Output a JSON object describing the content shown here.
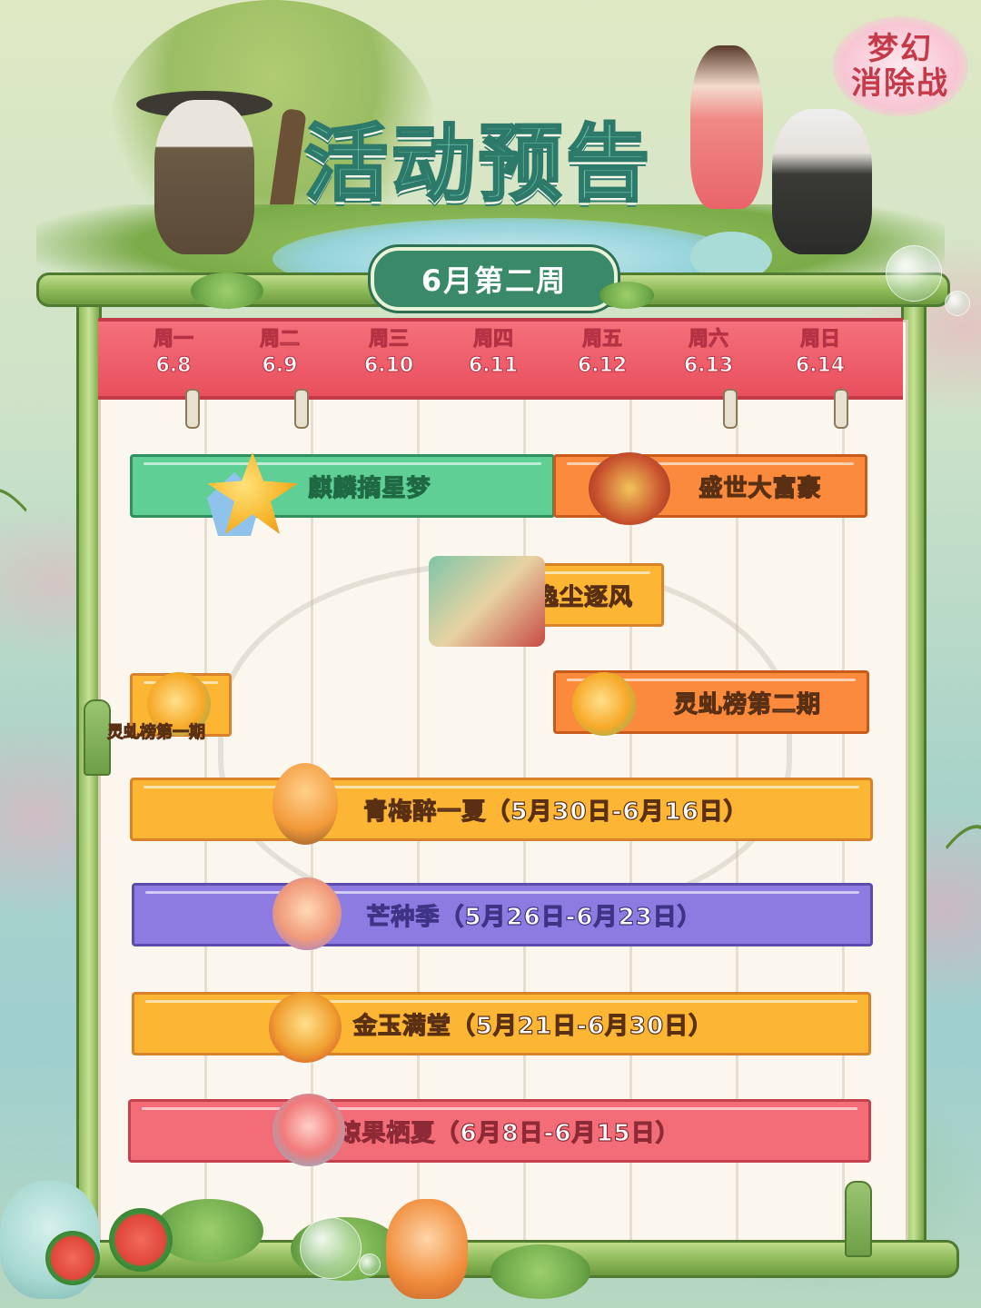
{
  "logo": {
    "line1": "梦幻",
    "line2": "消除战"
  },
  "title": "活动预告",
  "week_label": "6月第二周",
  "days": [
    {
      "name": "周一",
      "date": "6.8"
    },
    {
      "name": "周二",
      "date": "6.9"
    },
    {
      "name": "周三",
      "date": "6.10"
    },
    {
      "name": "周四",
      "date": "6.11"
    },
    {
      "name": "周五",
      "date": "6.12"
    },
    {
      "name": "周六",
      "date": "6.13"
    },
    {
      "name": "周日",
      "date": "6.14"
    }
  ],
  "events": {
    "qilin": {
      "label": "麒麟摘星梦",
      "color": "#5fcf96",
      "icon": "star-gem-icon"
    },
    "shengshi": {
      "label": "盛世大富豪",
      "color": "#fb8a3c",
      "icon": "treasure-chest-icon"
    },
    "yichen": {
      "label": "逸尘逐风",
      "color": "#fdb634",
      "icon": "lady-scene-icon"
    },
    "lingqiu1": {
      "label": "灵虬榜第一期",
      "color": "#fdb634",
      "icon": "golden-dragon-icon"
    },
    "lingqiu2": {
      "label": "灵虬榜第二期",
      "color": "#fb8a3c",
      "icon": "golden-dragon-icon"
    },
    "qingmei": {
      "label": "青梅醉一夏（5月30日-6月16日）",
      "color": "#fdb634",
      "icon": "fox-warrior-icon"
    },
    "mangzhong": {
      "label": "芒种季（5月26日-6月23日）",
      "color": "#8d7be2",
      "icon": "cat-straw-hat-icon"
    },
    "jinyu": {
      "label": "金玉满堂（5月21日-6月30日）",
      "color": "#fdb634",
      "icon": "gold-treasure-icon"
    },
    "qiongguo": {
      "label": "琼果栖夏（6月8日-6月15日）",
      "color": "#f36d78",
      "icon": "peach-cloud-icon"
    }
  }
}
